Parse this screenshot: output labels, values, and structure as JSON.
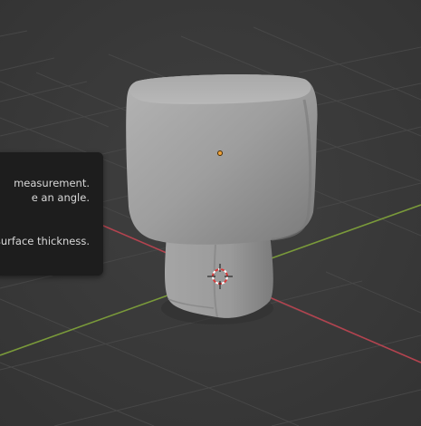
{
  "viewport": {
    "background": "#3a3a3a",
    "grid_color": "#4a4a4a",
    "x_axis_color": "#b3434f",
    "y_axis_color": "#7a9a3a",
    "object_color": "#9a9a9a"
  },
  "tooltip": {
    "line1": "measurement.",
    "line2": "e an angle.",
    "line3": "re surface thickness."
  },
  "icons": {
    "cursor": "3d-cursor-icon",
    "origin": "object-origin-icon"
  }
}
